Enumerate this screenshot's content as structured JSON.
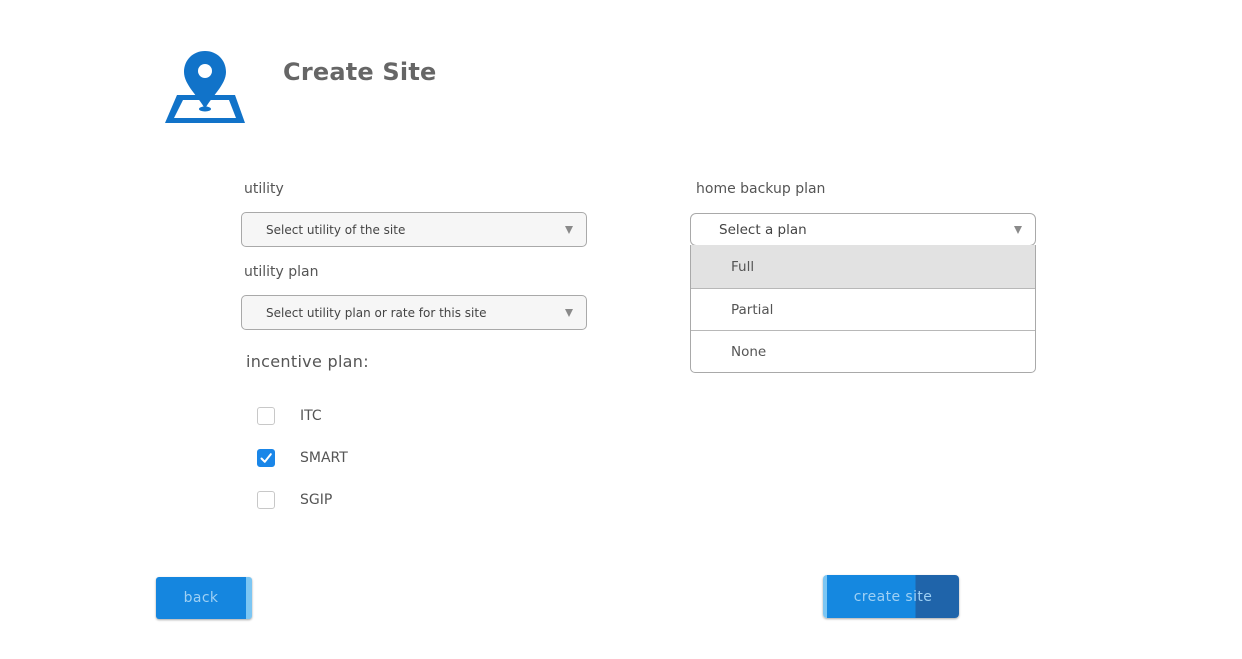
{
  "header": {
    "title": "Create Site",
    "logo_icon": "map-pin-icon"
  },
  "form": {
    "utility": {
      "label": "utility",
      "placeholder": "Select utility of the site"
    },
    "utility_plan": {
      "label": "utility plan",
      "placeholder": "Select utility plan or rate for this site"
    },
    "home_backup_plan": {
      "label": "home backup plan",
      "placeholder": "Select a plan",
      "options": [
        "Full",
        "Partial",
        "None"
      ],
      "highlighted_option": "Full"
    },
    "incentive_plan": {
      "label": "incentive plan:",
      "options": [
        {
          "label": "ITC",
          "checked": false
        },
        {
          "label": "SMART",
          "checked": true
        },
        {
          "label": "SGIP",
          "checked": false
        }
      ]
    }
  },
  "actions": {
    "back_label": "back",
    "create_label": "create site"
  },
  "colors": {
    "accent": "#1586df",
    "accent_dark": "#1f64aa",
    "checkbox_checked": "#1a86e8",
    "logo_blue": "#1173c9"
  }
}
